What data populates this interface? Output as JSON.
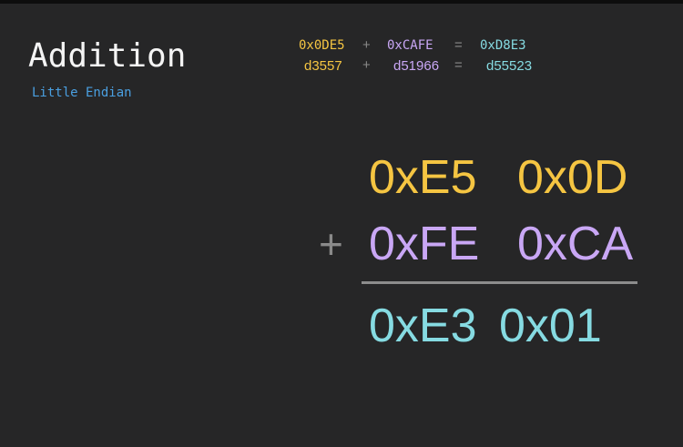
{
  "title": "Addition",
  "subtitle": "Little Endian",
  "hex_equation": {
    "a": "0x0DE5",
    "plus": "+",
    "b": "0xCAFE",
    "equals": "=",
    "result": "0xD8E3"
  },
  "dec_equation": {
    "a": "d3557",
    "plus": "+",
    "b": "d51966",
    "equals": "=",
    "result": "d55523"
  },
  "addition": {
    "row1": [
      "0xE5",
      "0x0D"
    ],
    "plus": "+",
    "row2": [
      "0xFE",
      "0xCA"
    ],
    "result": [
      "0xE3",
      "0x01"
    ]
  },
  "colors": {
    "operand_a": "#f5c542",
    "operand_b": "#c9a7f5",
    "result": "#86dbe2",
    "operator": "#8a8a8a",
    "subtitle": "#4a9fe0"
  }
}
